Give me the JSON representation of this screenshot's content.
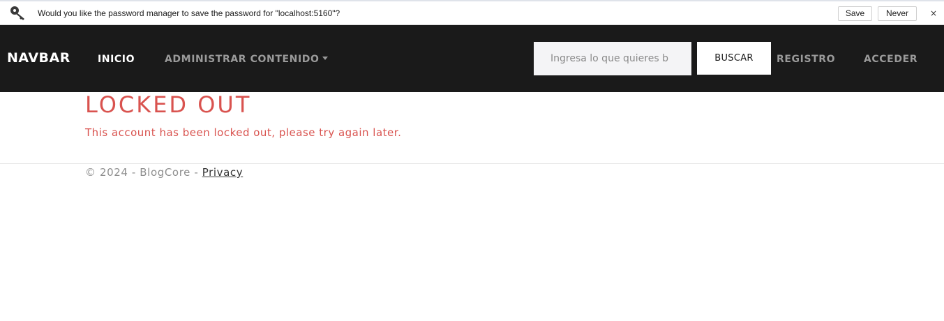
{
  "password_bar": {
    "message": "Would you like the password manager to save the password for \"localhost:5160\"?",
    "save_label": "Save",
    "never_label": "Never",
    "close_label": "×",
    "icon": "key-icon"
  },
  "navbar": {
    "brand": "NAVBAR",
    "links": {
      "inicio": "INICIO",
      "administrar": "ADMINISTRAR CONTENIDO",
      "registro": "REGISTRO",
      "acceder": "ACCEDER"
    },
    "search": {
      "placeholder": "Ingresa lo que quieres b",
      "button_label": "BUSCAR"
    }
  },
  "main": {
    "title": "LOCKED OUT",
    "message": "This account has been locked out, please try again later."
  },
  "footer": {
    "copyright": "© 2024 - BlogCore - ",
    "privacy_link": "Privacy"
  },
  "colors": {
    "navbar_bg": "#1a1a1a",
    "danger": "#d9534f",
    "muted_link": "#9a9a9a"
  }
}
